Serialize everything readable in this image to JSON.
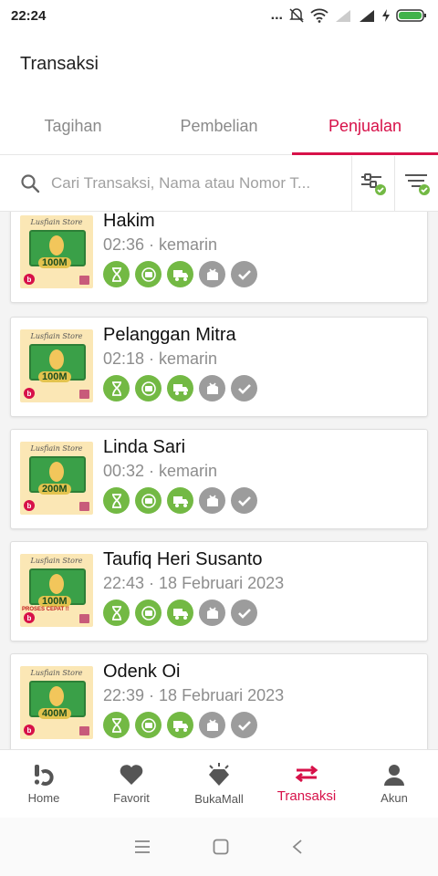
{
  "status_bar": {
    "time": "22:24",
    "dots": "..."
  },
  "app_bar": {
    "title": "Transaksi"
  },
  "tabs": [
    {
      "label": "Tagihan",
      "active": false
    },
    {
      "label": "Pembelian",
      "active": false
    },
    {
      "label": "Penjualan",
      "active": true
    }
  ],
  "search": {
    "placeholder": "Cari Transaksi, Nama atau Nomor T..."
  },
  "transactions": [
    {
      "name": "Hakim",
      "date": "02:36 · kemarin",
      "amount": "100M",
      "store": "Lusfiain Store",
      "steps": [
        "done",
        "done",
        "done",
        "todo",
        "todo"
      ]
    },
    {
      "name": "Pelanggan Mitra",
      "date": "02:18 · kemarin",
      "amount": "100M",
      "store": "Lusfiain Store",
      "steps": [
        "done",
        "done",
        "done",
        "todo",
        "todo"
      ]
    },
    {
      "name": "Linda Sari",
      "date": "00:32 · kemarin",
      "amount": "200M",
      "store": "Lusfiain Store",
      "steps": [
        "done",
        "done",
        "done",
        "todo",
        "todo"
      ]
    },
    {
      "name": "Taufiq Heri Susanto",
      "date": "22:43 · 18 Februari 2023",
      "amount": "100M",
      "store": "Lusfiain Store",
      "promo": "PROSES CEPAT !!",
      "steps": [
        "done",
        "done",
        "done",
        "todo",
        "todo"
      ]
    },
    {
      "name": "Odenk Oi",
      "date": "22:39 · 18 Februari 2023",
      "amount": "400M",
      "store": "Lusfiain Store",
      "steps": [
        "done",
        "done",
        "done",
        "todo",
        "todo"
      ]
    }
  ],
  "bottom_nav": [
    {
      "label": "Home",
      "icon": "bukalapak-logo-icon",
      "active": false
    },
    {
      "label": "Favorit",
      "icon": "heart-icon",
      "active": false
    },
    {
      "label": "BukaMall",
      "icon": "diamond-icon",
      "active": false
    },
    {
      "label": "Transaksi",
      "icon": "swap-arrows-icon",
      "active": true
    },
    {
      "label": "Akun",
      "icon": "person-icon",
      "active": false
    }
  ],
  "colors": {
    "accent": "#d71149",
    "step_done": "#73b944",
    "step_todo": "#9c9c9c"
  }
}
